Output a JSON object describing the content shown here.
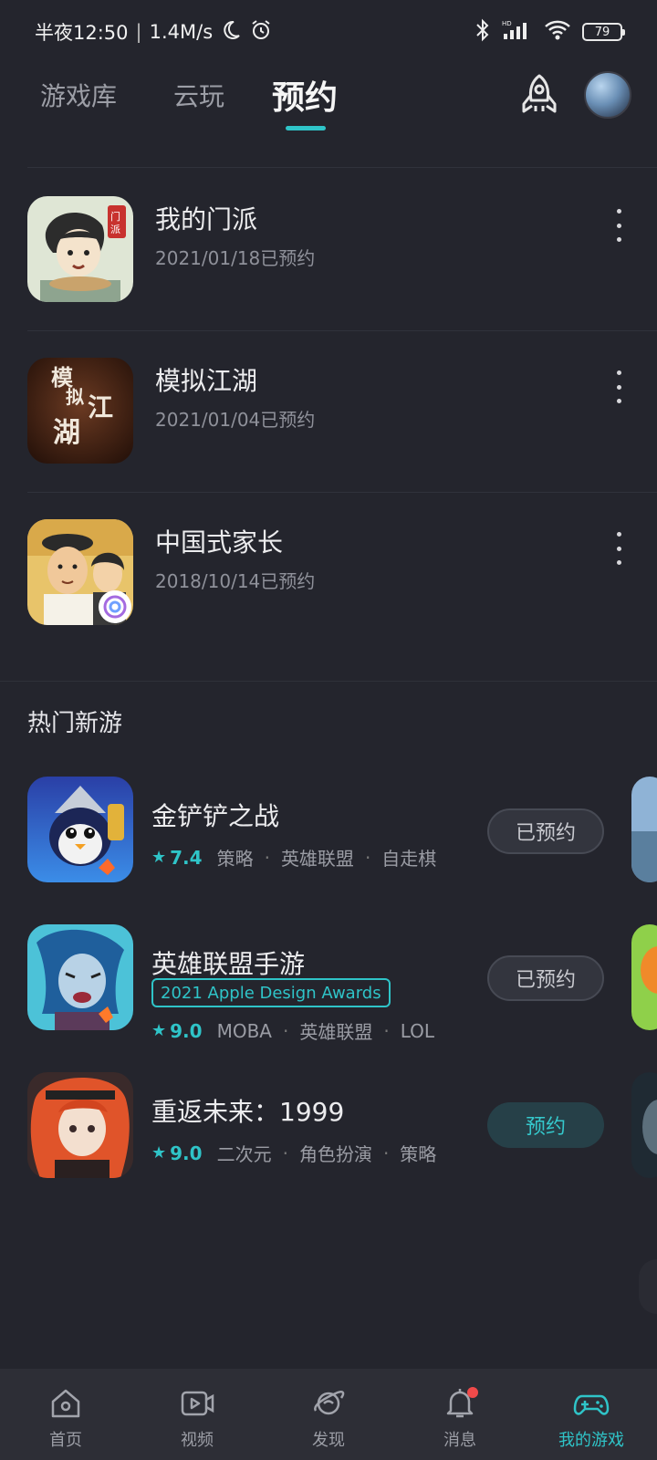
{
  "status_bar": {
    "time": "半夜12:50",
    "speed": "1.4M/s",
    "battery": "79"
  },
  "top_tabs": {
    "library": "游戏库",
    "cloud": "云玩",
    "reserve": "预约"
  },
  "reserved": [
    {
      "name": "我的门派",
      "date": "2021/01/18已预约",
      "icon": "game-icon-my-sect"
    },
    {
      "name": "模拟江湖",
      "date": "2021/01/04已预约",
      "icon": "game-icon-jianghu"
    },
    {
      "name": "中国式家长",
      "date": "2018/10/14已预约",
      "icon": "game-icon-chinese-parents"
    }
  ],
  "hot_section": {
    "title": "热门新游",
    "games": [
      {
        "name": "金铲铲之战",
        "score": "7.4",
        "tags": [
          "策略",
          "英雄联盟",
          "自走棋"
        ],
        "button": "已预约",
        "reserved": true
      },
      {
        "name": "英雄联盟手游",
        "award": "2021 Apple Design Awards",
        "score": "9.0",
        "tags": [
          "MOBA",
          "英雄联盟",
          "LOL"
        ],
        "button": "已预约",
        "reserved": true
      },
      {
        "name": "重返未来：1999",
        "score": "9.0",
        "tags": [
          "二次元",
          "角色扮演",
          "策略"
        ],
        "button": "预约",
        "reserved": false
      }
    ]
  },
  "bottom_nav": [
    {
      "label": "首页",
      "icon": "home-icon"
    },
    {
      "label": "视频",
      "icon": "video-icon"
    },
    {
      "label": "发现",
      "icon": "planet-icon"
    },
    {
      "label": "消息",
      "icon": "bell-icon"
    },
    {
      "label": "我的游戏",
      "icon": "gamepad-icon"
    }
  ],
  "colors": {
    "accent": "#2fc4c8",
    "background": "#24252d",
    "notification": "#f04a4a"
  }
}
